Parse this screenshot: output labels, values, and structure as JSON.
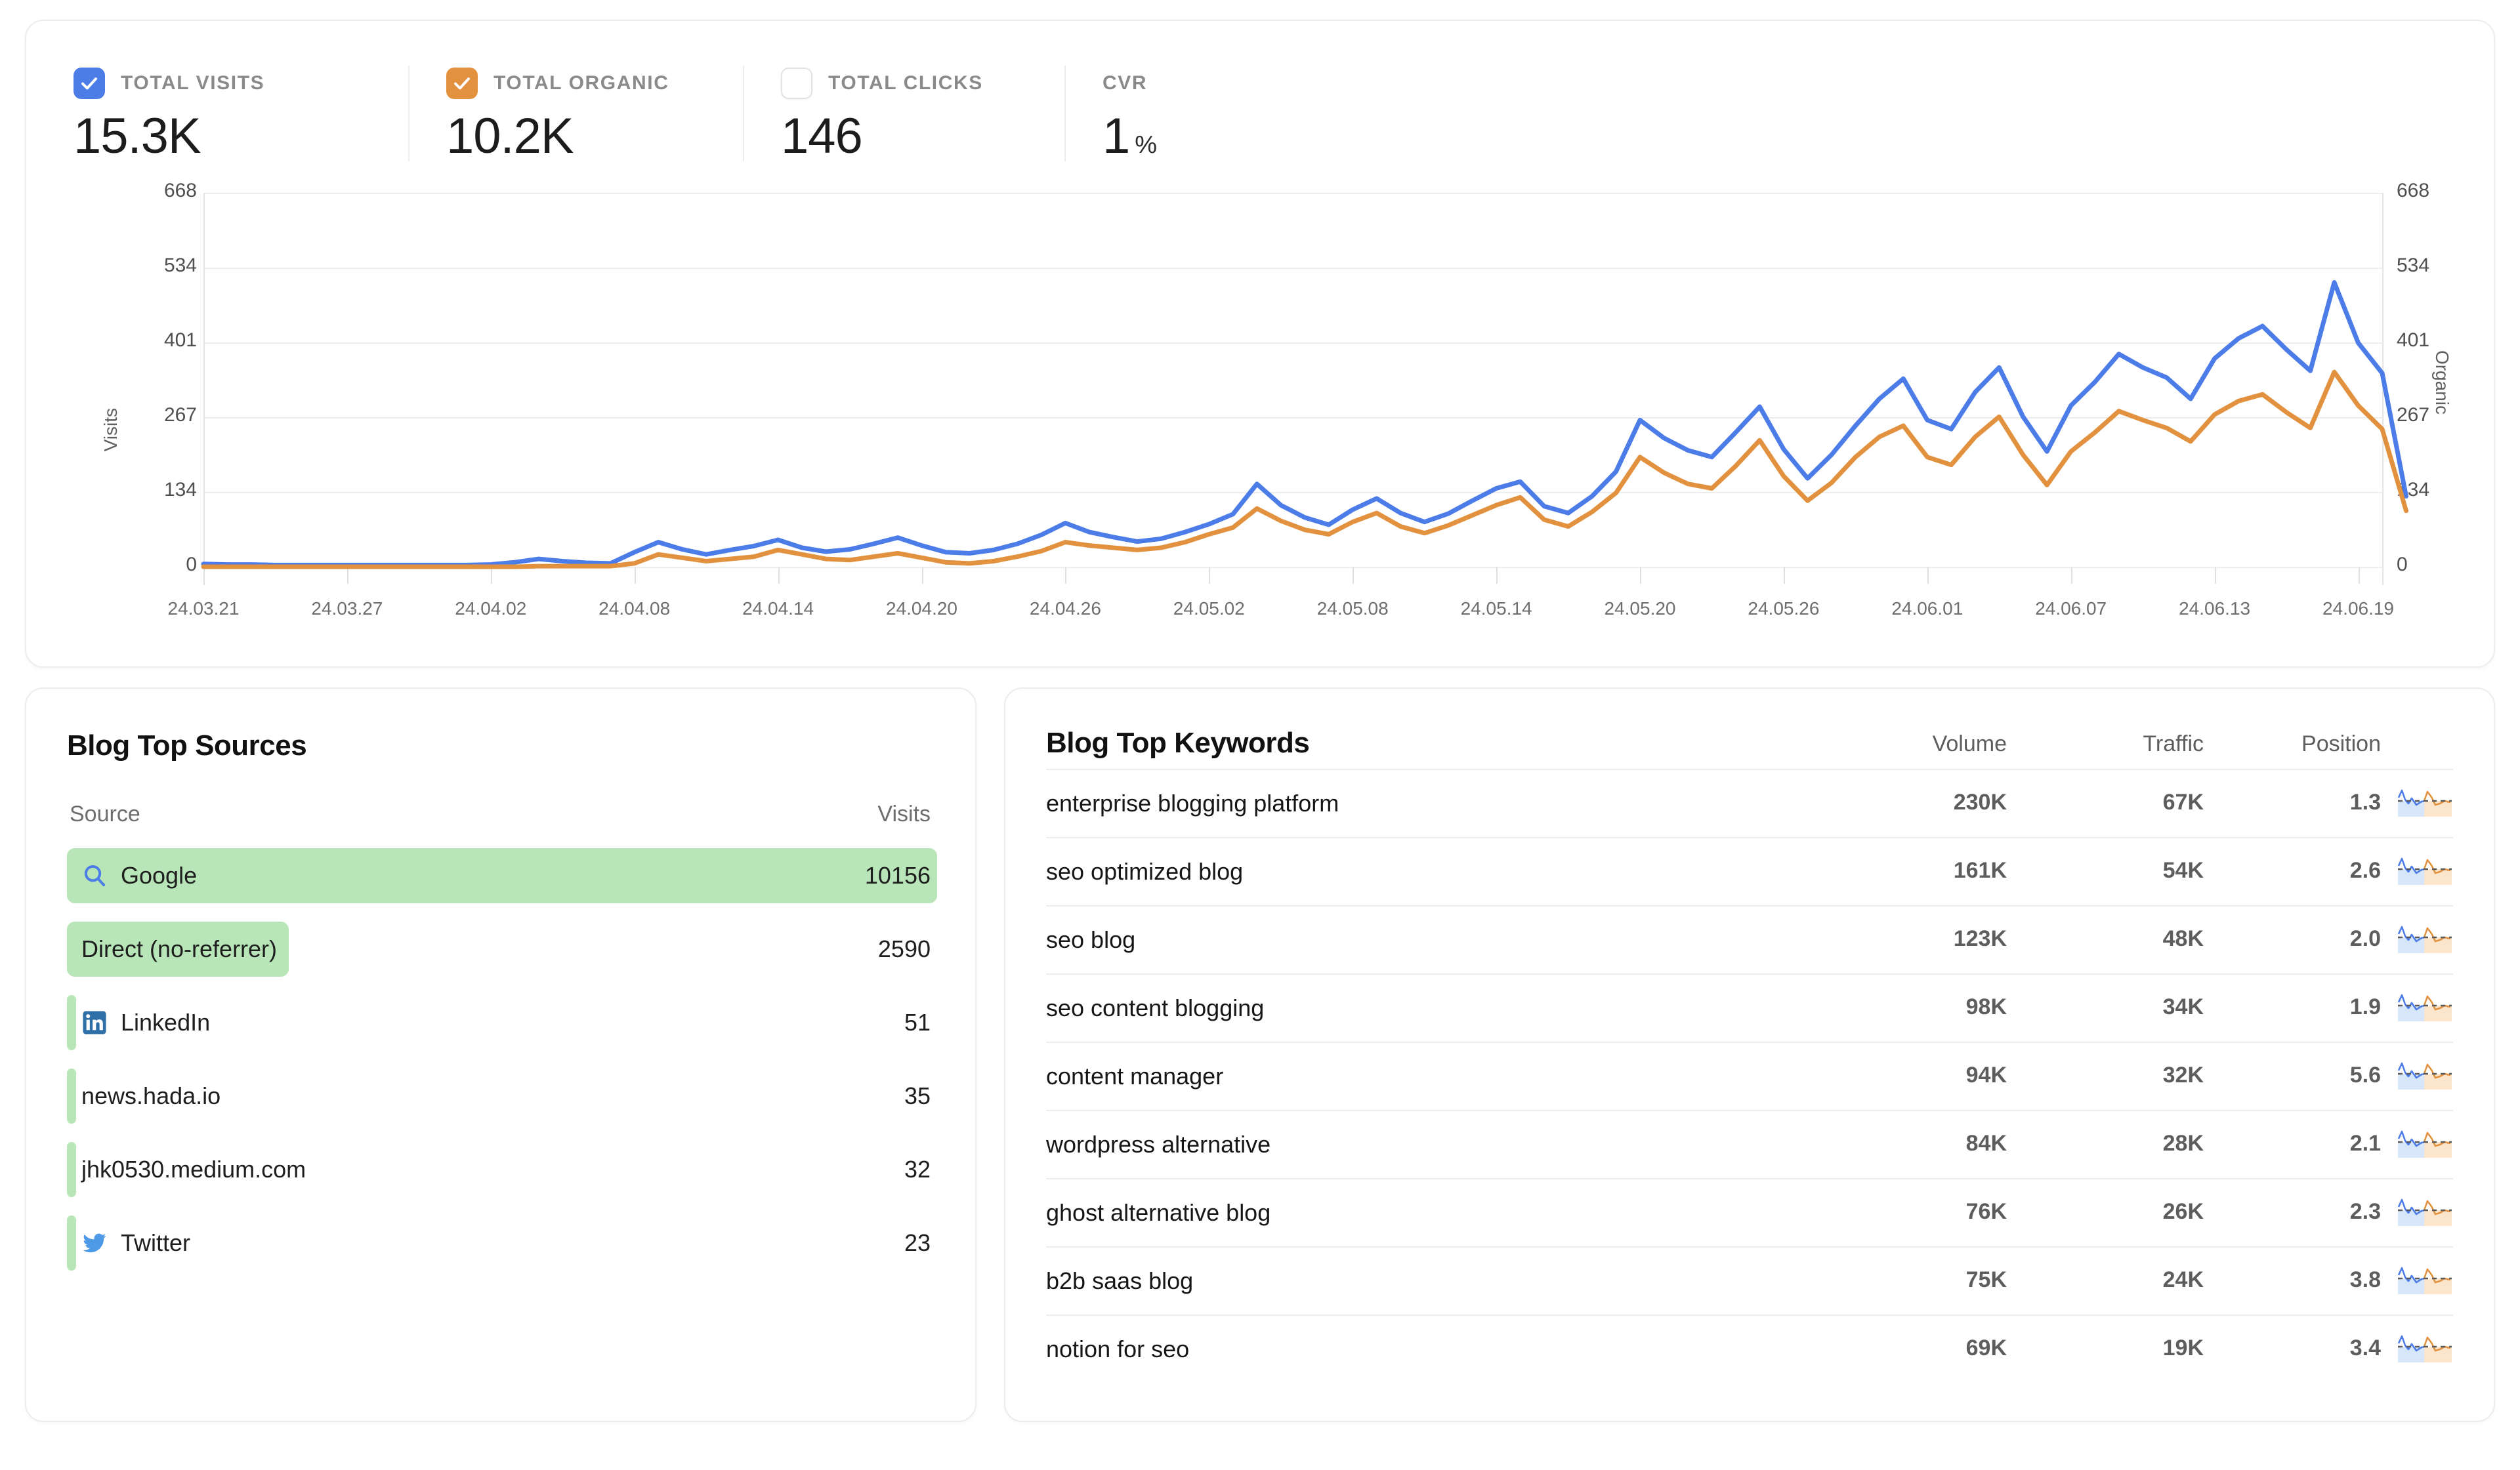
{
  "metrics": [
    {
      "label": "TOTAL VISITS",
      "value": "15.3K",
      "unit": "",
      "checked": true,
      "color": "#4c7ce8"
    },
    {
      "label": "TOTAL ORGANIC",
      "value": "10.2K",
      "unit": "",
      "checked": true,
      "color": "#e2913f"
    },
    {
      "label": "TOTAL CLICKS",
      "value": "146",
      "unit": "",
      "checked": false,
      "color": "#ffffff"
    },
    {
      "label": "CVR",
      "value": "1",
      "unit": "%",
      "checked": null,
      "color": ""
    }
  ],
  "chart_data": {
    "type": "line",
    "title": "",
    "xlabel": "",
    "ylabel": "Visits",
    "y2label": "Organic",
    "ylim": [
      0,
      668
    ],
    "y2lim": [
      0,
      668
    ],
    "yticks": [
      "0",
      "134",
      "267",
      "401",
      "534",
      "668"
    ],
    "y2ticks": [
      "0",
      "134",
      "267",
      "401",
      "534",
      "668"
    ],
    "grid": true,
    "legend": "none",
    "xticks": [
      "24.03.21",
      "24.03.27",
      "24.04.02",
      "24.04.08",
      "24.04.14",
      "24.04.20",
      "24.04.26",
      "24.05.02",
      "24.05.08",
      "24.05.14",
      "24.05.20",
      "24.05.26",
      "24.06.01",
      "24.06.07",
      "24.06.13",
      "24.06.19"
    ],
    "x": [
      "24.03.21",
      "24.03.22",
      "24.03.23",
      "24.03.24",
      "24.03.25",
      "24.03.26",
      "24.03.27",
      "24.03.28",
      "24.03.29",
      "24.03.30",
      "24.03.31",
      "24.04.01",
      "24.04.02",
      "24.04.03",
      "24.04.04",
      "24.04.05",
      "24.04.06",
      "24.04.07",
      "24.04.08",
      "24.04.09",
      "24.04.10",
      "24.04.11",
      "24.04.12",
      "24.04.13",
      "24.04.14",
      "24.04.15",
      "24.04.16",
      "24.04.17",
      "24.04.18",
      "24.04.19",
      "24.04.20",
      "24.04.21",
      "24.04.22",
      "24.04.23",
      "24.04.24",
      "24.04.25",
      "24.04.26",
      "24.04.27",
      "24.04.28",
      "24.04.29",
      "24.04.30",
      "24.05.01",
      "24.05.02",
      "24.05.03",
      "24.05.04",
      "24.05.05",
      "24.05.06",
      "24.05.07",
      "24.05.08",
      "24.05.09",
      "24.05.10",
      "24.05.11",
      "24.05.12",
      "24.05.13",
      "24.05.14",
      "24.05.15",
      "24.05.16",
      "24.05.17",
      "24.05.18",
      "24.05.19",
      "24.05.20",
      "24.05.21",
      "24.05.22",
      "24.05.23",
      "24.05.24",
      "24.05.25",
      "24.05.26",
      "24.05.27",
      "24.05.28",
      "24.05.29",
      "24.05.30",
      "24.05.31",
      "24.06.01",
      "24.06.02",
      "24.06.03",
      "24.06.04",
      "24.06.05",
      "24.06.06",
      "24.06.07",
      "24.06.08",
      "24.06.09",
      "24.06.10",
      "24.06.11",
      "24.06.12",
      "24.06.13",
      "24.06.14",
      "24.06.15",
      "24.06.16",
      "24.06.17",
      "24.06.18",
      "24.06.19",
      "24.06.20"
    ],
    "series": [
      {
        "name": "Visits",
        "color": "#4c7ce8",
        "axis": "left",
        "values": [
          5,
          4,
          4,
          3,
          3,
          3,
          3,
          3,
          3,
          3,
          3,
          3,
          4,
          8,
          14,
          10,
          7,
          6,
          26,
          44,
          31,
          22,
          30,
          37,
          48,
          34,
          27,
          31,
          41,
          52,
          38,
          26,
          24,
          30,
          41,
          57,
          78,
          62,
          53,
          45,
          50,
          62,
          76,
          94,
          148,
          110,
          88,
          75,
          102,
          122,
          96,
          80,
          95,
          118,
          140,
          152,
          108,
          96,
          126,
          170,
          262,
          230,
          208,
          196,
          240,
          286,
          210,
          158,
          200,
          252,
          300,
          336,
          262,
          246,
          312,
          356,
          268,
          206,
          288,
          330,
          380,
          356,
          338,
          300,
          372,
          408,
          430,
          388,
          350,
          508,
          400,
          346,
          126
        ]
      },
      {
        "name": "Organic",
        "color": "#e2913f",
        "axis": "right",
        "values": [
          0,
          0,
          0,
          0,
          0,
          0,
          0,
          0,
          0,
          0,
          0,
          0,
          0,
          0,
          1,
          1,
          1,
          1,
          6,
          22,
          16,
          10,
          14,
          18,
          30,
          22,
          14,
          12,
          18,
          24,
          16,
          8,
          6,
          10,
          18,
          28,
          44,
          38,
          34,
          30,
          34,
          44,
          58,
          70,
          104,
          82,
          66,
          58,
          80,
          96,
          72,
          60,
          74,
          92,
          110,
          124,
          84,
          72,
          98,
          132,
          196,
          168,
          148,
          140,
          180,
          226,
          162,
          118,
          150,
          196,
          232,
          252,
          196,
          182,
          232,
          268,
          200,
          146,
          206,
          240,
          278,
          262,
          248,
          224,
          272,
          296,
          308,
          276,
          248,
          348,
          288,
          246,
          100
        ]
      }
    ]
  },
  "sources": {
    "title": "Blog Top Sources",
    "col_source": "Source",
    "col_visits": "Visits",
    "rows": [
      {
        "name": "Google",
        "visits": "10156",
        "pct": 100,
        "icon": "google-search-icon"
      },
      {
        "name": "Direct (no-referrer)",
        "visits": "2590",
        "pct": 25.5,
        "icon": "none"
      },
      {
        "name": "LinkedIn",
        "visits": "51",
        "pct": 0.5,
        "icon": "linkedin-icon"
      },
      {
        "name": "news.hada.io",
        "visits": "35",
        "pct": 0.35,
        "icon": "none"
      },
      {
        "name": "jhk0530.medium.com",
        "visits": "32",
        "pct": 0.32,
        "icon": "none"
      },
      {
        "name": "Twitter",
        "visits": "23",
        "pct": 0.23,
        "icon": "twitter-icon"
      }
    ]
  },
  "keywords": {
    "title": "Blog Top Keywords",
    "columns": [
      "Volume",
      "Traffic",
      "Position"
    ],
    "rows": [
      {
        "keyword": "enterprise blogging platform",
        "volume": "230K",
        "traffic": "67K",
        "position": "1.3"
      },
      {
        "keyword": "seo optimized blog",
        "volume": "161K",
        "traffic": "54K",
        "position": "2.6"
      },
      {
        "keyword": "seo blog",
        "volume": "123K",
        "traffic": "48K",
        "position": "2.0"
      },
      {
        "keyword": "seo content blogging",
        "volume": "98K",
        "traffic": "34K",
        "position": "1.9"
      },
      {
        "keyword": "content manager",
        "volume": "94K",
        "traffic": "32K",
        "position": "5.6"
      },
      {
        "keyword": "wordpress alternative",
        "volume": "84K",
        "traffic": "28K",
        "position": "2.1"
      },
      {
        "keyword": "ghost alternative blog",
        "volume": "76K",
        "traffic": "26K",
        "position": "2.3"
      },
      {
        "keyword": "b2b saas blog",
        "volume": "75K",
        "traffic": "24K",
        "position": "3.8"
      },
      {
        "keyword": "notion for seo",
        "volume": "69K",
        "traffic": "19K",
        "position": "3.4"
      }
    ]
  },
  "colors": {
    "visits_blue": "#4c7ce8",
    "organic_orange": "#e2913f",
    "bar_green": "#b8e6b8"
  }
}
